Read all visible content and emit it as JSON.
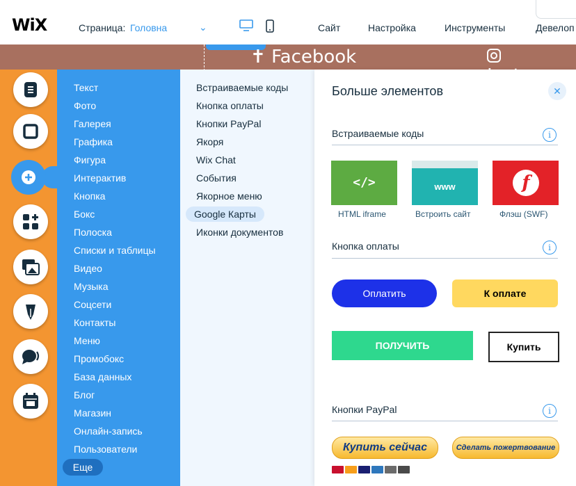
{
  "topbar": {
    "logo": "WiX",
    "page_label": "Страница:",
    "page_name": "Головна",
    "menu": [
      "Сайт",
      "Настройка",
      "Инструменты",
      "Девелоп"
    ]
  },
  "site": {
    "facebook_text": "Facebook",
    "instagram_text": "Instagra"
  },
  "rail": {
    "buttons": [
      "text-icon",
      "box-icon",
      "add-icon",
      "apps-icon",
      "media-icon",
      "pen-icon",
      "chat-icon",
      "calendar-icon"
    ]
  },
  "categories": [
    "Текст",
    "Фото",
    "Галерея",
    "Графика",
    "Фигура",
    "Интерактив",
    "Кнопка",
    "Бокс",
    "Полоска",
    "Списки и таблицы",
    "Видео",
    "Музыка",
    "Соцсети",
    "Контакты",
    "Меню",
    "Промобокс",
    "База данных",
    "Блог",
    "Магазин",
    "Онлайн-запись",
    "Пользователи"
  ],
  "categories_more": "Еще",
  "subcategories": [
    "Встраиваемые коды",
    "Кнопка оплаты",
    "Кнопки PayPal",
    "Якоря",
    "Wix Chat",
    "События",
    "Якорное меню",
    "Google Карты",
    "Иконки документов"
  ],
  "main": {
    "title": "Больше элементов",
    "sections": {
      "embed": "Встраиваемые коды",
      "payment": "Кнопка оплаты",
      "paypal": "Кнопки PayPal"
    },
    "embeds": [
      {
        "caption": "HTML iframe",
        "glyph": "</>"
      },
      {
        "caption": "Встроить сайт",
        "glyph": "www"
      },
      {
        "caption": "Флэш (SWF)",
        "glyph": "f"
      }
    ],
    "pay_buttons": [
      "Оплатить",
      "К оплате",
      "ПОЛУЧИТЬ",
      "Купить"
    ],
    "paypal_buttons": [
      "Купить сейчас",
      "Сделать пожертвование"
    ]
  },
  "colors": {
    "accent": "#3899ec",
    "rail": "#f39531",
    "site_strip": "#a8705f"
  }
}
